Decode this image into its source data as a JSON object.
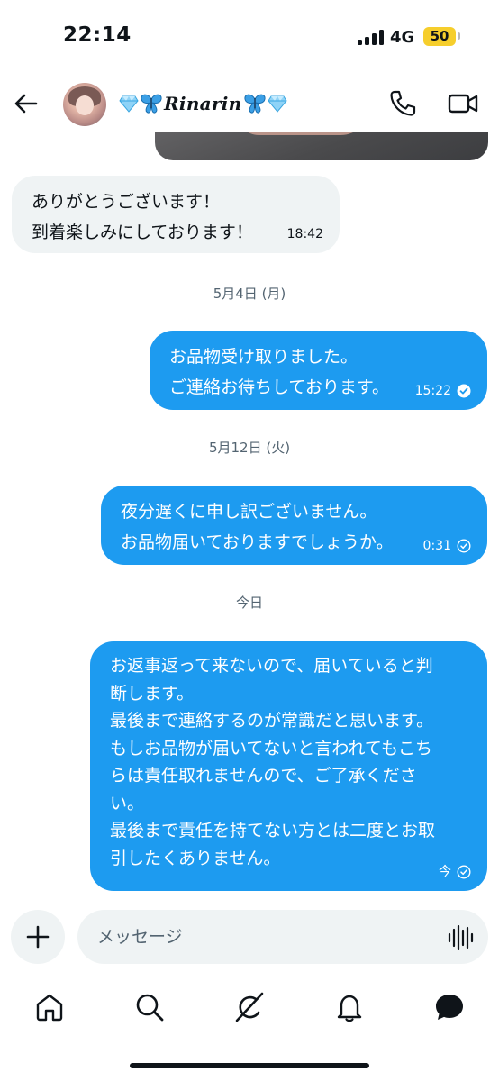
{
  "status_bar": {
    "time": "22:14",
    "network": "4G",
    "battery": "50",
    "battery_color": "#f6ce2c"
  },
  "header": {
    "contact_name": "Rinarin",
    "name_decorations": [
      "gem-icon",
      "butterfly-icon",
      "butterfly-icon",
      "gem-icon"
    ],
    "icons": [
      "back-arrow-icon",
      "phone-icon",
      "video-camera-icon"
    ]
  },
  "messages": [
    {
      "direction": "in",
      "lines": [
        "ありがとうございます！",
        "到着楽しみにしております！"
      ],
      "time": "18:42"
    },
    {
      "direction": "separator",
      "date": "5月4日 (月)"
    },
    {
      "direction": "out",
      "lines": [
        "お品物受け取りました。",
        "ご連絡お待ちしております。"
      ],
      "time": "15:22",
      "status": "seen"
    },
    {
      "direction": "separator",
      "date": "5月12日 (火)"
    },
    {
      "direction": "out",
      "lines": [
        "夜分遅くに申し訳ございません。",
        "お品物届いておりますでしょうか。"
      ],
      "time": "0:31",
      "status": "sent"
    },
    {
      "direction": "separator",
      "date": "今日"
    },
    {
      "direction": "out",
      "lines": [
        "お返事返って来ないので、届いていると判",
        "断します。",
        "最後まで連絡するのが常識だと思います。",
        "もしお品物が届いてないと言われてもこち",
        "らは責任取れませんので、ご了承くださ",
        "い。",
        "最後まで責任を持てない方とは二度とお取",
        "引したくありません。"
      ],
      "time": "今",
      "status": "sent"
    }
  ],
  "composer": {
    "placeholder": "メッセージ",
    "icons": [
      "plus-icon",
      "voice-waveform-icon"
    ]
  },
  "bottom_nav": {
    "items": [
      "home-icon",
      "search-icon",
      "grok-icon",
      "notifications-bell-icon",
      "messages-bubble-icon"
    ],
    "active": "messages-bubble-icon"
  },
  "colors": {
    "outgoing_bubble": "#1d9bf0",
    "incoming_bubble": "#eff3f4",
    "text": "#0f1419",
    "secondary_text": "#536471"
  }
}
